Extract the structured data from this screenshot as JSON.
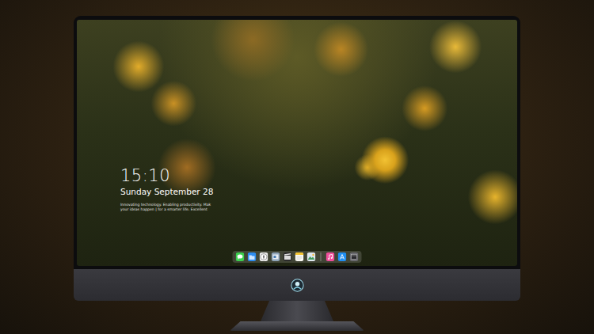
{
  "lock_screen": {
    "time": "15:10",
    "date": "Sunday September 28",
    "tagline": [
      "Innovating technology. Enabling productivity. Mak",
      "your ideas happen | for a smarter life. Excellent"
    ]
  },
  "dock": {
    "items": [
      {
        "kind": "messages"
      },
      {
        "kind": "files"
      },
      {
        "kind": "browser"
      },
      {
        "kind": "preview"
      },
      {
        "kind": "video"
      },
      {
        "kind": "notes"
      },
      {
        "kind": "photos"
      },
      {
        "kind": "separator"
      },
      {
        "kind": "music"
      },
      {
        "kind": "store"
      },
      {
        "kind": "window"
      }
    ]
  }
}
